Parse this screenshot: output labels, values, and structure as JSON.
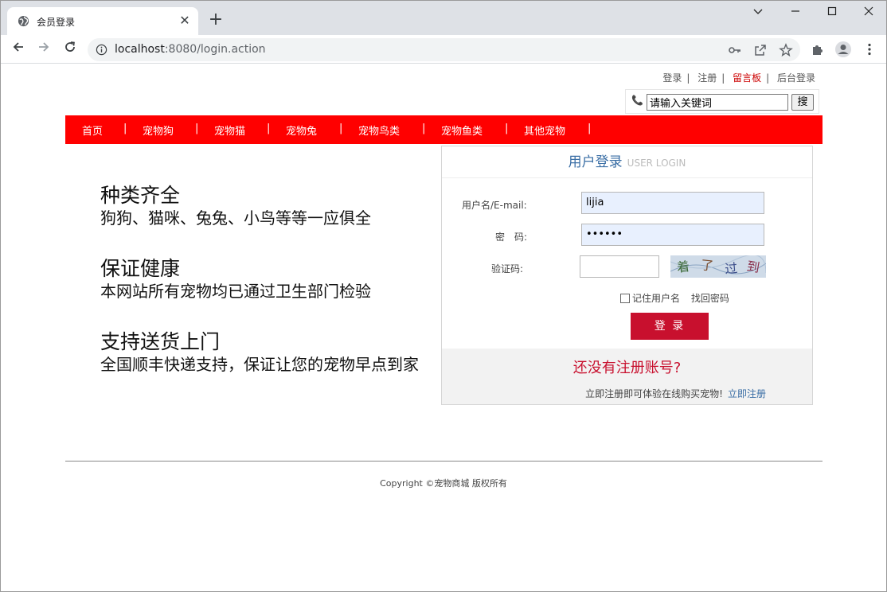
{
  "browser": {
    "tab_title": "会员登录",
    "url_host": "localhost",
    "url_rest": ":8080/login.action"
  },
  "top_links": [
    "登录",
    "注册",
    "留言板",
    "后台登录"
  ],
  "search": {
    "value": "请输入关键词",
    "button": "搜"
  },
  "nav": [
    "首页",
    "宠物狗",
    "宠物猫",
    "宠物兔",
    "宠物鸟类",
    "宠物鱼类",
    "其他宠物"
  ],
  "promo": [
    {
      "heading": "种类齐全",
      "text": "狗狗、猫咪、兔兔、小鸟等等一应俱全"
    },
    {
      "heading": "保证健康",
      "text": "本网站所有宠物均已通过卫生部门检验"
    },
    {
      "heading": "支持送货上门",
      "text": "全国顺丰快递支持，保证让您的宠物早点到家"
    }
  ],
  "login": {
    "title": "用户登录",
    "title_en": "USER LOGIN",
    "username_label": "用户名/E-mail:",
    "username_value": "lijia",
    "password_label": "密　码:",
    "password_value": "••••••",
    "captcha_label": "验证码:",
    "captcha_text": "着了过到",
    "remember_label": "记住用户名",
    "forgot_label": "找回密码",
    "login_button": "登 录",
    "no_account": "还没有注册账号?",
    "register_note": "立即注册即可体验在线购买宠物!",
    "register_link": "立即注册"
  },
  "footer": {
    "copyright": "Copyright ©宠物商城 版权所有"
  },
  "colors": {
    "nav_bg": "#ff0000",
    "login_button": "#c8102e",
    "link_blue": "#3a6ea5"
  }
}
